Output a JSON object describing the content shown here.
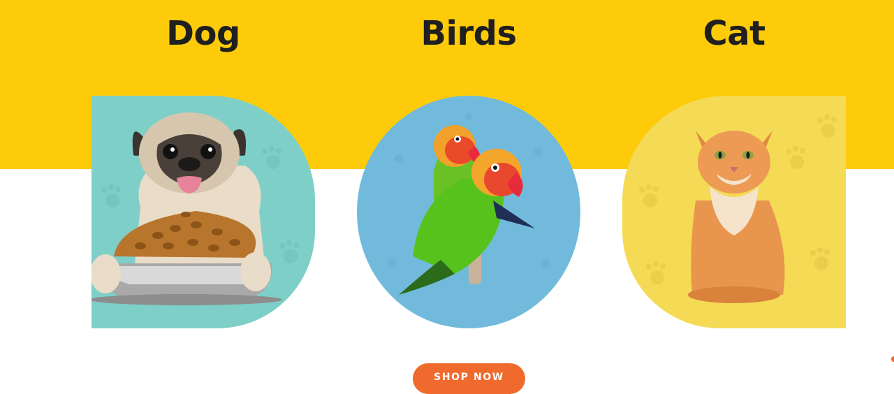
{
  "categories": [
    {
      "title": "Dog"
    },
    {
      "title": "Birds"
    },
    {
      "title": "Cat"
    }
  ],
  "cta": {
    "label": "SHOP NOW"
  },
  "colors": {
    "band": "#FDCB09",
    "dog_tile": "#7ECFC8",
    "bird_tile": "#72BADB",
    "cat_tile": "#F4DA55",
    "button": "#F06A2D"
  }
}
